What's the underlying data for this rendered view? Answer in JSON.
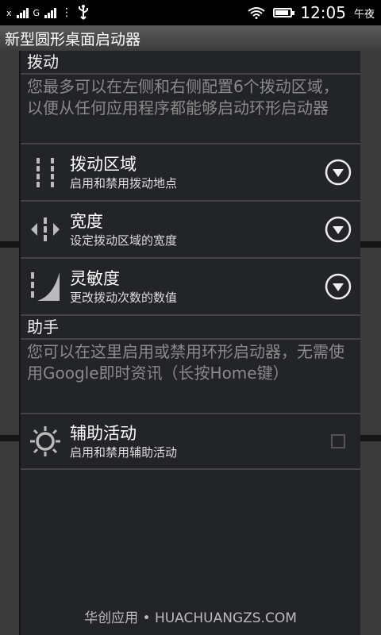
{
  "status_bar": {
    "left_text_1": "x",
    "left_text_2": "G",
    "usb_icon": "usb-icon",
    "wifi_icon": "wifi-icon",
    "battery_level": 1.0,
    "time": "12:05",
    "period": "午夜"
  },
  "app": {
    "title": "新型圆形桌面启动器"
  },
  "sections": {
    "swipe": {
      "header": "拨动",
      "description": "您最多可以在左侧和右侧配置6个拨动区域，以便从任何应用程序都能够启动环形启动器"
    },
    "assistant": {
      "header": "助手",
      "description": "您可以在这里启用或禁用环形启动器，无需使用Google即时资讯（长按Home键）"
    }
  },
  "items": [
    {
      "title": "拨动区域",
      "summary": "启用和禁用拨动地点",
      "icon": "swipe-zones-icon"
    },
    {
      "title": "宽度",
      "summary": "设定拨动区域的宽度",
      "icon": "width-icon"
    },
    {
      "title": "灵敏度",
      "summary": "更改拨动次数的数值",
      "icon": "sensitivity-icon"
    }
  ],
  "assist_item": {
    "title": "辅助活动",
    "summary": "启用和禁用辅助活动",
    "icon": "assist-activity-icon",
    "checked": false
  },
  "footer": {
    "watermark": "华创应用 • HUACHUANGZS.COM"
  }
}
